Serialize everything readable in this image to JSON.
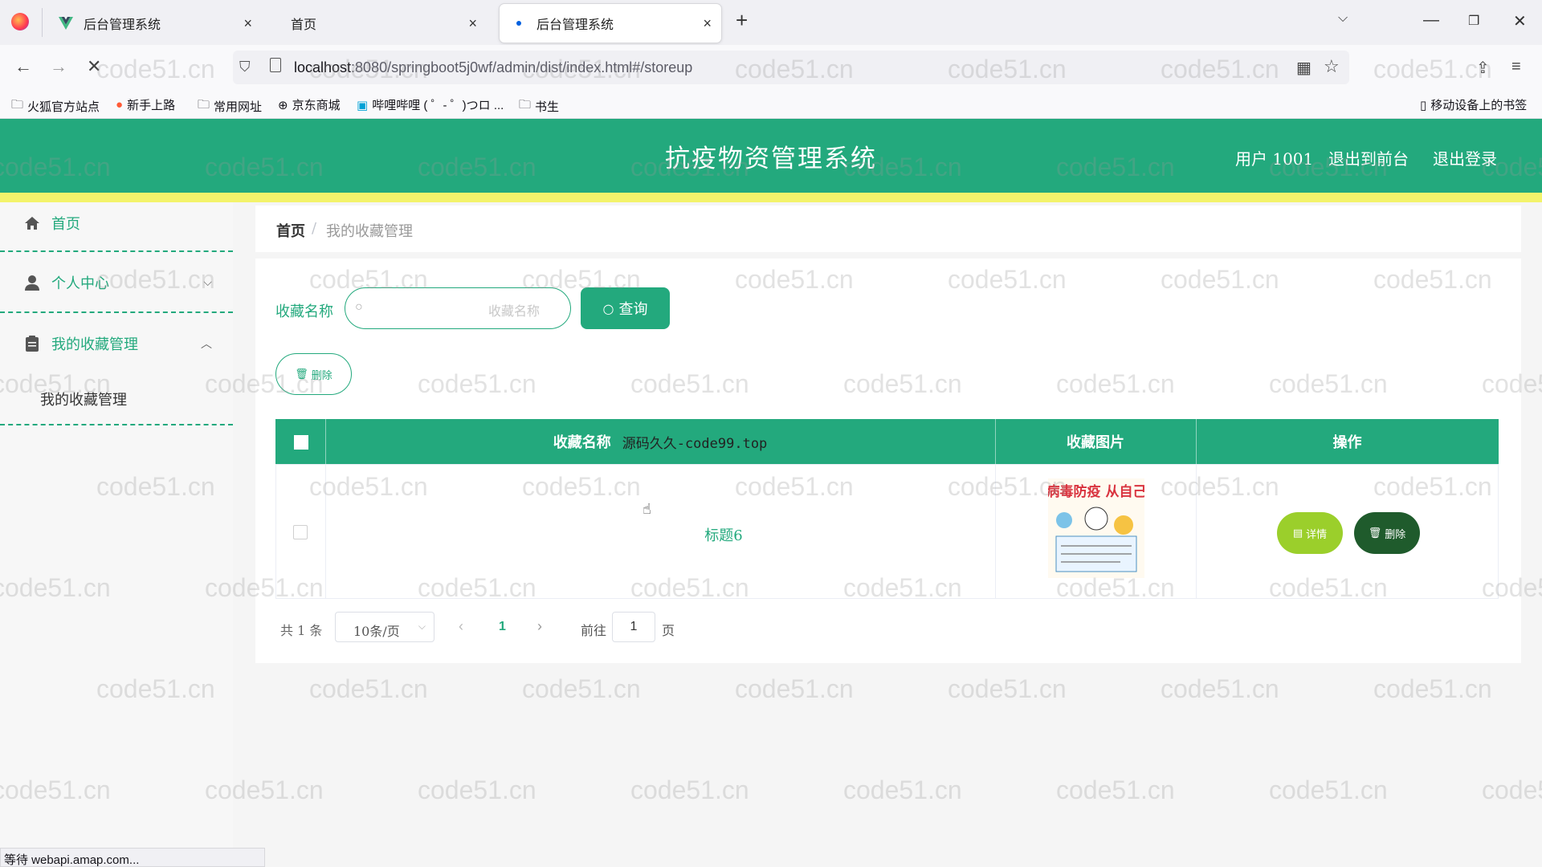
{
  "browser": {
    "tabs": [
      {
        "title": "后台管理系统",
        "close": "×"
      },
      {
        "title": "首页",
        "close": "×"
      },
      {
        "title": "后台管理系统",
        "close": "×"
      }
    ],
    "new_tab": "+",
    "url_host": "localhost",
    "url_rest": ":8080/springboot5j0wf/admin/dist/index.html#/storeup",
    "bookmarks": [
      "火狐官方站点",
      "新手上路",
      "常用网址",
      "京东商城",
      "哔哩哔哩 ( ゜- ゜)つロ ...",
      "书生"
    ],
    "mobile_bookmarks": "移动设备上的书签",
    "status_text": "等待 webapi.amap.com..."
  },
  "header": {
    "title": "抗疫物资管理系统",
    "user": "用户 1001",
    "back_front": "退出到前台",
    "logout": "退出登录"
  },
  "sidebar": {
    "items": [
      {
        "label": "首页"
      },
      {
        "label": "个人中心"
      },
      {
        "label": "我的收藏管理"
      }
    ],
    "sub_item": "我的收藏管理"
  },
  "breadcrumb": {
    "home": "首页",
    "separator": "/",
    "current": "我的收藏管理"
  },
  "search": {
    "label": "收藏名称",
    "placeholder": "收藏名称",
    "button": "查询"
  },
  "toolbar": {
    "delete": "删除"
  },
  "table": {
    "columns": [
      "收藏名称",
      "收藏图片",
      "操作"
    ],
    "watermark_text": "源码久久-code99.top",
    "rows": [
      {
        "name": "标题6",
        "image_text": "抗击病毒防疫 从自己做起",
        "detail": "详情",
        "delete": "删除"
      }
    ]
  },
  "pagination": {
    "total": "共 1 条",
    "page_size": "10条/页",
    "current": "1",
    "goto_label": "前往",
    "goto_value": "1",
    "unit": "页"
  },
  "watermark": "code51.cn",
  "colors": {
    "primary": "#23a97d",
    "accent_bar": "#f3f36b",
    "detail_btn": "#9bcf2b",
    "delete_btn": "#1f5b2c"
  }
}
